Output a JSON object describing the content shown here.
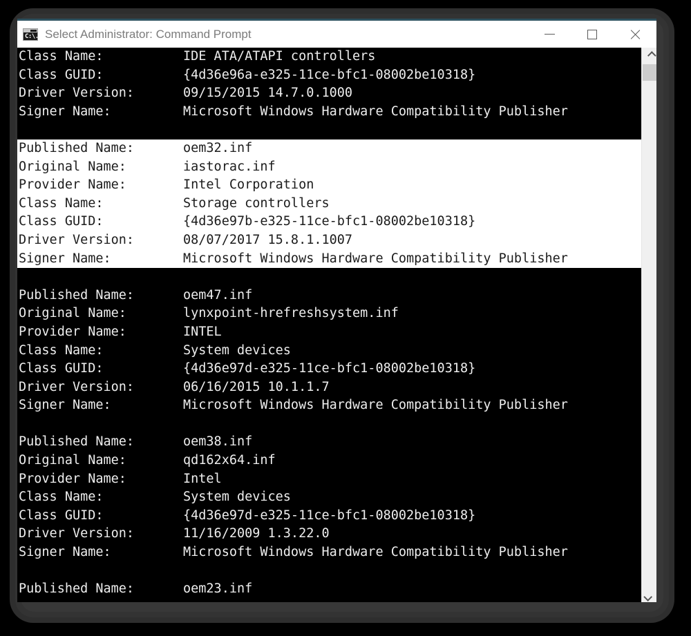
{
  "window": {
    "title": "Select Administrator: Command Prompt",
    "icon": "command-prompt-icon",
    "icon_prompt": "C:\\.",
    "accent_border_color": "#2e5260",
    "titlebar_bg": "#ffffff",
    "title_color": "#7b7b7b",
    "buttons": {
      "minimize": "minimize",
      "maximize": "maximize",
      "close": "close"
    }
  },
  "scrollbar": {
    "up_arrow": "scroll-up",
    "down_arrow": "scroll-down",
    "thumb": "scroll-thumb"
  },
  "console": {
    "bg": "#000000",
    "fg": "#eeeeee",
    "selection_bg": "#ffffff",
    "selection_fg": "#1c1c1c",
    "blocks": [
      {
        "selected": false,
        "lines": [
          {
            "key": "Class Name:",
            "value": "IDE ATA/ATAPI controllers"
          },
          {
            "key": "Class GUID:",
            "value": "{4d36e96a-e325-11ce-bfc1-08002be10318}"
          },
          {
            "key": "Driver Version:",
            "value": "09/15/2015 14.7.0.1000"
          },
          {
            "key": "Signer Name:",
            "value": "Microsoft Windows Hardware Compatibility Publisher"
          }
        ]
      },
      {
        "selected": true,
        "lines": [
          {
            "key": "Published Name:",
            "value": "oem32.inf"
          },
          {
            "key": "Original Name:",
            "value": "iastorac.inf"
          },
          {
            "key": "Provider Name:",
            "value": "Intel Corporation"
          },
          {
            "key": "Class Name:",
            "value": "Storage controllers"
          },
          {
            "key": "Class GUID:",
            "value": "{4d36e97b-e325-11ce-bfc1-08002be10318}"
          },
          {
            "key": "Driver Version:",
            "value": "08/07/2017 15.8.1.1007"
          },
          {
            "key": "Signer Name:",
            "value": "Microsoft Windows Hardware Compatibility Publisher"
          }
        ]
      },
      {
        "selected": false,
        "lines": [
          {
            "key": "Published Name:",
            "value": "oem47.inf"
          },
          {
            "key": "Original Name:",
            "value": "lynxpoint-hrefreshsystem.inf"
          },
          {
            "key": "Provider Name:",
            "value": "INTEL"
          },
          {
            "key": "Class Name:",
            "value": "System devices"
          },
          {
            "key": "Class GUID:",
            "value": "{4d36e97d-e325-11ce-bfc1-08002be10318}"
          },
          {
            "key": "Driver Version:",
            "value": "06/16/2015 10.1.1.7"
          },
          {
            "key": "Signer Name:",
            "value": "Microsoft Windows Hardware Compatibility Publisher"
          }
        ]
      },
      {
        "selected": false,
        "lines": [
          {
            "key": "Published Name:",
            "value": "oem38.inf"
          },
          {
            "key": "Original Name:",
            "value": "qd162x64.inf"
          },
          {
            "key": "Provider Name:",
            "value": "Intel"
          },
          {
            "key": "Class Name:",
            "value": "System devices"
          },
          {
            "key": "Class GUID:",
            "value": "{4d36e97d-e325-11ce-bfc1-08002be10318}"
          },
          {
            "key": "Driver Version:",
            "value": "11/16/2009 1.3.22.0"
          },
          {
            "key": "Signer Name:",
            "value": "Microsoft Windows Hardware Compatibility Publisher"
          }
        ]
      },
      {
        "selected": false,
        "lines": [
          {
            "key": "Published Name:",
            "value": "oem23.inf"
          }
        ]
      }
    ]
  }
}
